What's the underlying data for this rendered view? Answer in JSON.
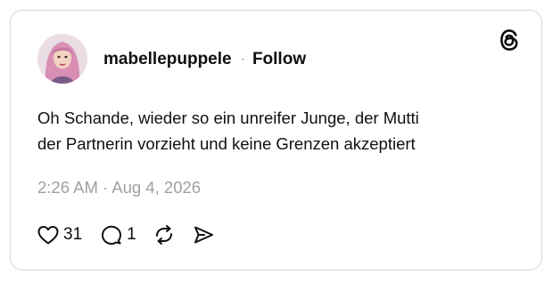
{
  "post": {
    "username": "mabellepuppele",
    "separator": "·",
    "follow_label": "Follow",
    "text_lines": [
      "Oh Schande, wieder so ein unreifer Junge, der Mutti",
      "der Partnerin vorzieht und keine Grenzen akzeptiert"
    ],
    "timestamp": "2:26 AM · Aug 4, 2026",
    "like_count": "31",
    "reply_count": "1"
  },
  "icons": {
    "brand": "threads-logo-icon",
    "like": "heart-icon",
    "reply": "speech-bubble-icon",
    "repost": "repost-arrows-icon",
    "share": "send-icon"
  },
  "colors": {
    "text": "#101010",
    "muted": "#a0a0a0",
    "border": "#d6d6d6"
  }
}
